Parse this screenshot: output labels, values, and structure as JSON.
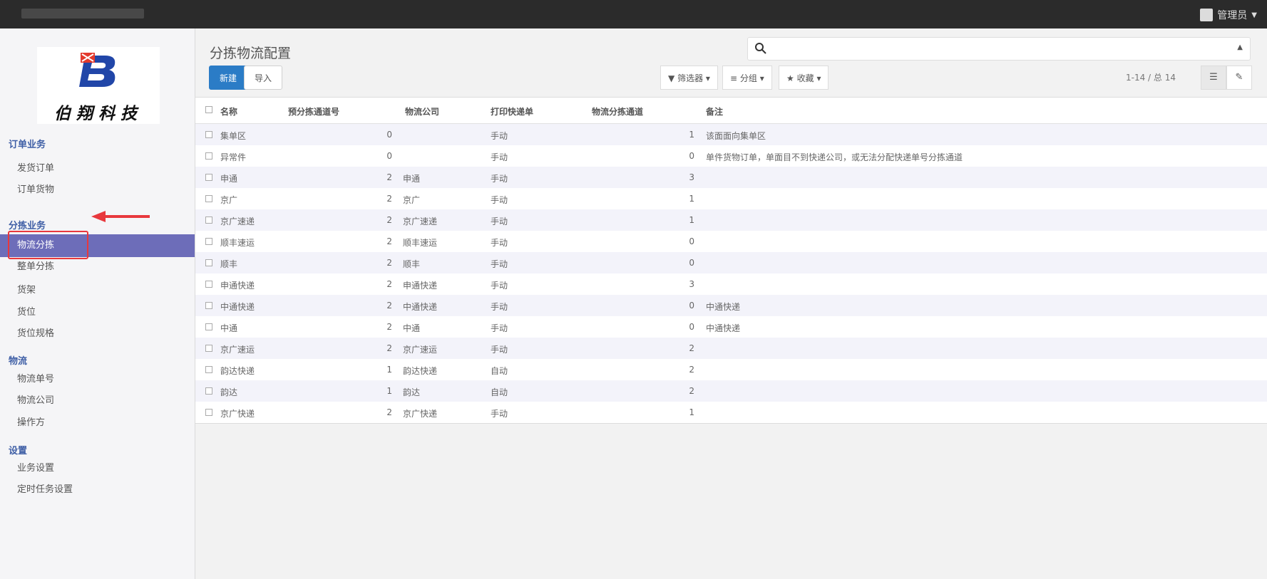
{
  "topbar": {
    "user": "管理员"
  },
  "logo": {
    "text": "伯翔科技"
  },
  "sidebar": {
    "sections": [
      {
        "title": "订单业务",
        "items": [
          "发货订单",
          "订单货物"
        ]
      },
      {
        "title": "分拣业务",
        "items": [
          "物流分拣",
          "整单分拣"
        ]
      },
      {
        "title": "",
        "items": [
          "货架",
          "货位",
          "货位规格"
        ]
      },
      {
        "title": "物流",
        "items": [
          "物流单号",
          "物流公司",
          "操作方"
        ]
      },
      {
        "title": "设置",
        "items": [
          "业务设置",
          "定时任务设置"
        ]
      }
    ],
    "active": "物流分拣"
  },
  "header": {
    "title": "分拣物流配置",
    "new_button": "新建",
    "import_button": "导入",
    "filter_label": "筛选器",
    "group_label": "分组",
    "favorites_label": "收藏",
    "pager": "1-14 / 总 14"
  },
  "table": {
    "columns": [
      "名称",
      "预分拣通道号",
      "物流公司",
      "打印快递单",
      "物流分拣通道",
      "备注"
    ],
    "rows": [
      [
        "集单区",
        "0",
        "",
        "手动",
        "1",
        "该面面向集单区"
      ],
      [
        "异常件",
        "0",
        "",
        "手动",
        "0",
        "单件货物订单，单面目不到快递公司，或无法分配快递单号分拣通道"
      ],
      [
        "申通",
        "2",
        "申通",
        "手动",
        "3",
        ""
      ],
      [
        "京广",
        "2",
        "京广",
        "手动",
        "1",
        ""
      ],
      [
        "京广速递",
        "2",
        "京广速递",
        "手动",
        "1",
        ""
      ],
      [
        "顺丰速运",
        "2",
        "顺丰速运",
        "手动",
        "0",
        ""
      ],
      [
        "顺丰",
        "2",
        "顺丰",
        "手动",
        "0",
        ""
      ],
      [
        "申通快递",
        "2",
        "申通快递",
        "手动",
        "3",
        ""
      ],
      [
        "中通快递",
        "2",
        "中通快递",
        "手动",
        "0",
        "中通快递"
      ],
      [
        "中通",
        "2",
        "中通",
        "手动",
        "0",
        "中通快递"
      ],
      [
        "京广速运",
        "2",
        "京广速运",
        "手动",
        "2",
        ""
      ],
      [
        "韵达快递",
        "1",
        "韵达快递",
        "自动",
        "2",
        ""
      ],
      [
        "韵达",
        "1",
        "韵达",
        "自动",
        "2",
        ""
      ],
      [
        "京广快递",
        "2",
        "京广快递",
        "手动",
        "1",
        ""
      ]
    ]
  }
}
